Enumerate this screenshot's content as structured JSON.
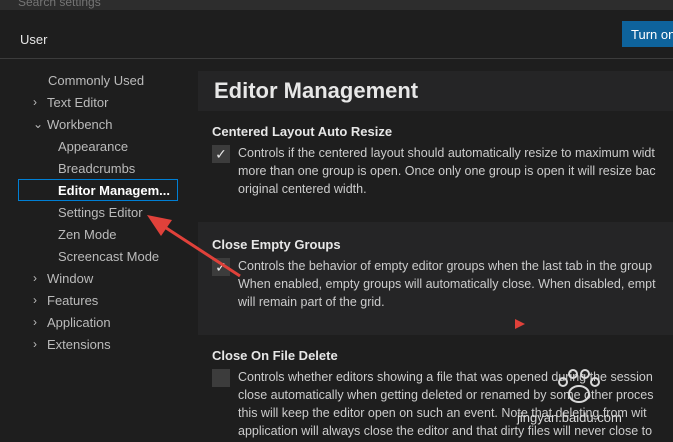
{
  "search": {
    "placeholder": "Search settings"
  },
  "tabs": {
    "user_label": "User"
  },
  "sync_button": {
    "label": "Turn on"
  },
  "toc": {
    "items": [
      {
        "label": "Commonly Used",
        "indent": 0,
        "chevron": ""
      },
      {
        "label": "Text Editor",
        "indent": 0,
        "chevron": "chevron-right"
      },
      {
        "label": "Workbench",
        "indent": 0,
        "chevron": "chevron-down"
      },
      {
        "label": "Appearance",
        "indent": 1,
        "chevron": ""
      },
      {
        "label": "Breadcrumbs",
        "indent": 1,
        "chevron": ""
      },
      {
        "label": "Editor Managem...",
        "indent": 1,
        "chevron": "",
        "selected": true
      },
      {
        "label": "Settings Editor",
        "indent": 1,
        "chevron": ""
      },
      {
        "label": "Zen Mode",
        "indent": 1,
        "chevron": ""
      },
      {
        "label": "Screencast Mode",
        "indent": 1,
        "chevron": ""
      },
      {
        "label": "Window",
        "indent": 0,
        "chevron": "chevron-right"
      },
      {
        "label": "Features",
        "indent": 0,
        "chevron": "chevron-right"
      },
      {
        "label": "Application",
        "indent": 0,
        "chevron": "chevron-right"
      },
      {
        "label": "Extensions",
        "indent": 0,
        "chevron": "chevron-right"
      }
    ]
  },
  "content": {
    "section_title": "Editor Management",
    "settings": [
      {
        "title": "Centered Layout Auto Resize",
        "checked": true,
        "description_lines": [
          "Controls if the centered layout should automatically resize to maximum widt",
          "more than one group is open. Once only one group is open it will resize bac",
          "original centered width."
        ]
      },
      {
        "title": "Close Empty Groups",
        "checked": true,
        "description_lines": [
          "Controls the behavior of empty editor groups when the last tab in the group",
          "When enabled, empty groups will automatically close. When disabled, empt",
          "will remain part of the grid."
        ]
      },
      {
        "title": "Close On File Delete",
        "checked": false,
        "description_lines": [
          "Controls whether editors showing a file that was opened during the session",
          "close automatically when getting deleted or renamed by some other proces",
          "this will keep the editor open on such an event. Note that deleting from wit",
          "application will always close the editor and that dirty files will never close to"
        ]
      }
    ]
  },
  "colors": {
    "accent": "#0e639c",
    "focus_border": "#007fd4",
    "annotation_arrow": "#e0413a"
  },
  "watermark": {
    "text": "jingyan.baidu.com"
  }
}
